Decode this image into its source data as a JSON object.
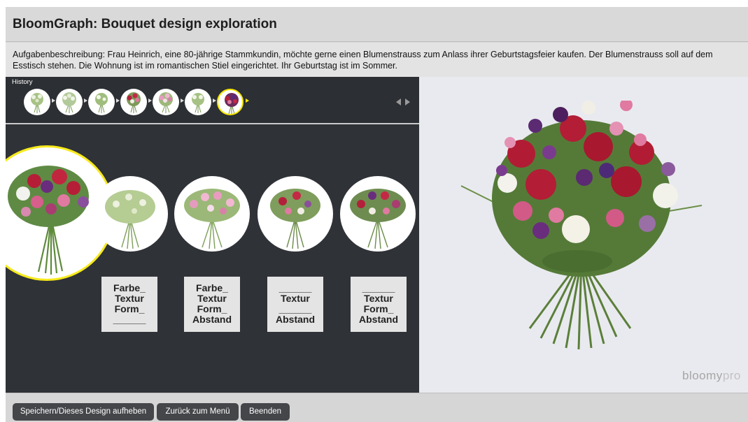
{
  "header": {
    "title": "BloomGraph: Bouquet design exploration"
  },
  "task": {
    "text": "Aufgabenbeschreibung: Frau Heinrich, eine 80-jährige Stammkundin, möchte gerne einen Blumenstrauss zum Anlass ihrer Geburtstagsfeier kaufen. Der Blumenstrauss soll auf dem Esstisch stehen. Die Wohnung ist im romantischen Stiel eingerichtet. Ihr Geburtstag ist im Sommer."
  },
  "history": {
    "label": "History",
    "items": [
      {
        "icon": "bouquet-thumb-icon",
        "palette": "green-white"
      },
      {
        "icon": "bouquet-thumb-icon",
        "palette": "green-white"
      },
      {
        "icon": "bouquet-thumb-icon",
        "palette": "green-white"
      },
      {
        "icon": "bouquet-thumb-icon",
        "palette": "red-pink"
      },
      {
        "icon": "bouquet-thumb-icon",
        "palette": "pink-pastel"
      },
      {
        "icon": "bouquet-thumb-icon",
        "palette": "green-white"
      },
      {
        "icon": "bouquet-thumb-icon",
        "palette": "purple-red",
        "selected": true
      }
    ],
    "nav_icons": [
      "chevron-left-icon",
      "chevron-right-icon"
    ]
  },
  "options": [
    {
      "lines": [
        "Farbe_",
        "Textur",
        "Form_",
        "______"
      ]
    },
    {
      "lines": [
        "Farbe_",
        "Textur",
        "Form_",
        "Abstand"
      ]
    },
    {
      "lines": [
        "______",
        "Textur",
        "______",
        "Abstand"
      ]
    },
    {
      "lines": [
        "______",
        "Textur",
        "Form_",
        "Abstand"
      ]
    }
  ],
  "brand": {
    "name": "bloomy",
    "suffix": "pro"
  },
  "buttons": {
    "save": "Speichern/Dieses Design aufheben",
    "back": "Zurück zum Menü",
    "quit": "Beenden"
  },
  "colors": {
    "selection": "#f7ea1b",
    "panel_dark": "#2f3237",
    "button": "#444649"
  }
}
